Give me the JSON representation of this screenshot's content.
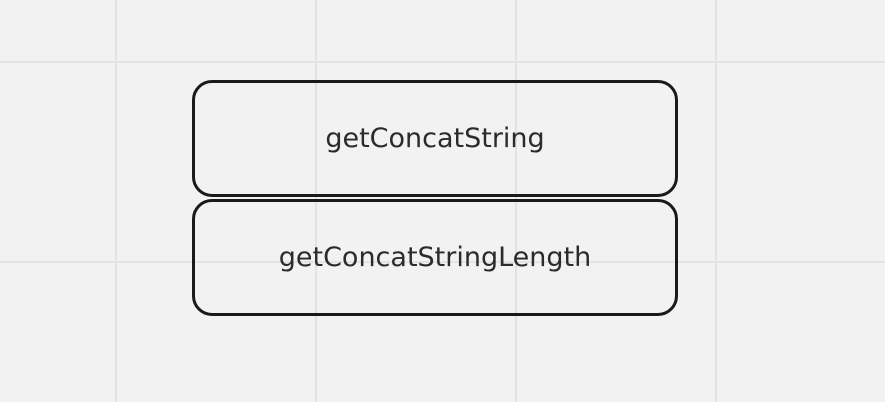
{
  "diagram": {
    "nodes": [
      {
        "label": "getConcatString"
      },
      {
        "label": "getConcatStringLength"
      }
    ]
  },
  "colors": {
    "background": "#f2f2f2",
    "grid": "#e3e3e3",
    "node_border": "#1a1a1a",
    "text": "#2b2b2b"
  }
}
